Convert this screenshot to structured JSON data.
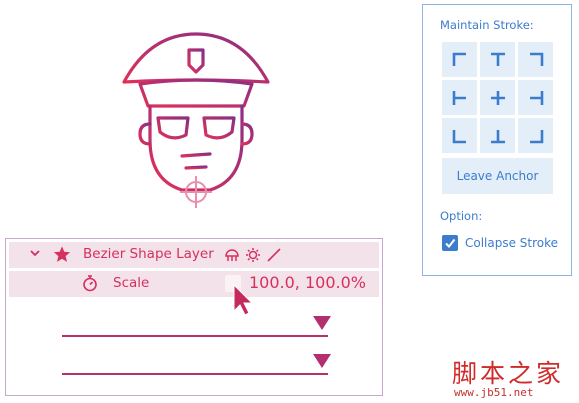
{
  "layer_panel": {
    "layer_row": {
      "name": "Bezier Shape Layer"
    },
    "property_row": {
      "label": "Scale",
      "value": "100.0, 100.0%"
    }
  },
  "stroke_panel": {
    "title": "Maintain Stroke:",
    "anchors": [
      {
        "name": "anchor-top-left",
        "glyph": "top-left"
      },
      {
        "name": "anchor-top-center",
        "glyph": "top-center"
      },
      {
        "name": "anchor-top-right",
        "glyph": "top-right"
      },
      {
        "name": "anchor-middle-left",
        "glyph": "middle-left"
      },
      {
        "name": "anchor-center",
        "glyph": "center"
      },
      {
        "name": "anchor-middle-right",
        "glyph": "middle-right"
      },
      {
        "name": "anchor-bottom-left",
        "glyph": "bottom-left"
      },
      {
        "name": "anchor-bottom-center",
        "glyph": "bottom-center"
      },
      {
        "name": "anchor-bottom-right",
        "glyph": "bottom-right"
      }
    ],
    "leave_anchor_label": "Leave Anchor",
    "option_label": "Option:",
    "collapse_stroke": {
      "label": "Collapse Stroke",
      "checked": true
    }
  },
  "watermark": {
    "text": "脚本之家",
    "url": "www.jb51.net"
  },
  "colors": {
    "accent_pink": "#d6305d",
    "accent_blue": "#3b7ccd",
    "row_bg": "#f3e2ea",
    "button_bg": "#e4eef9"
  }
}
